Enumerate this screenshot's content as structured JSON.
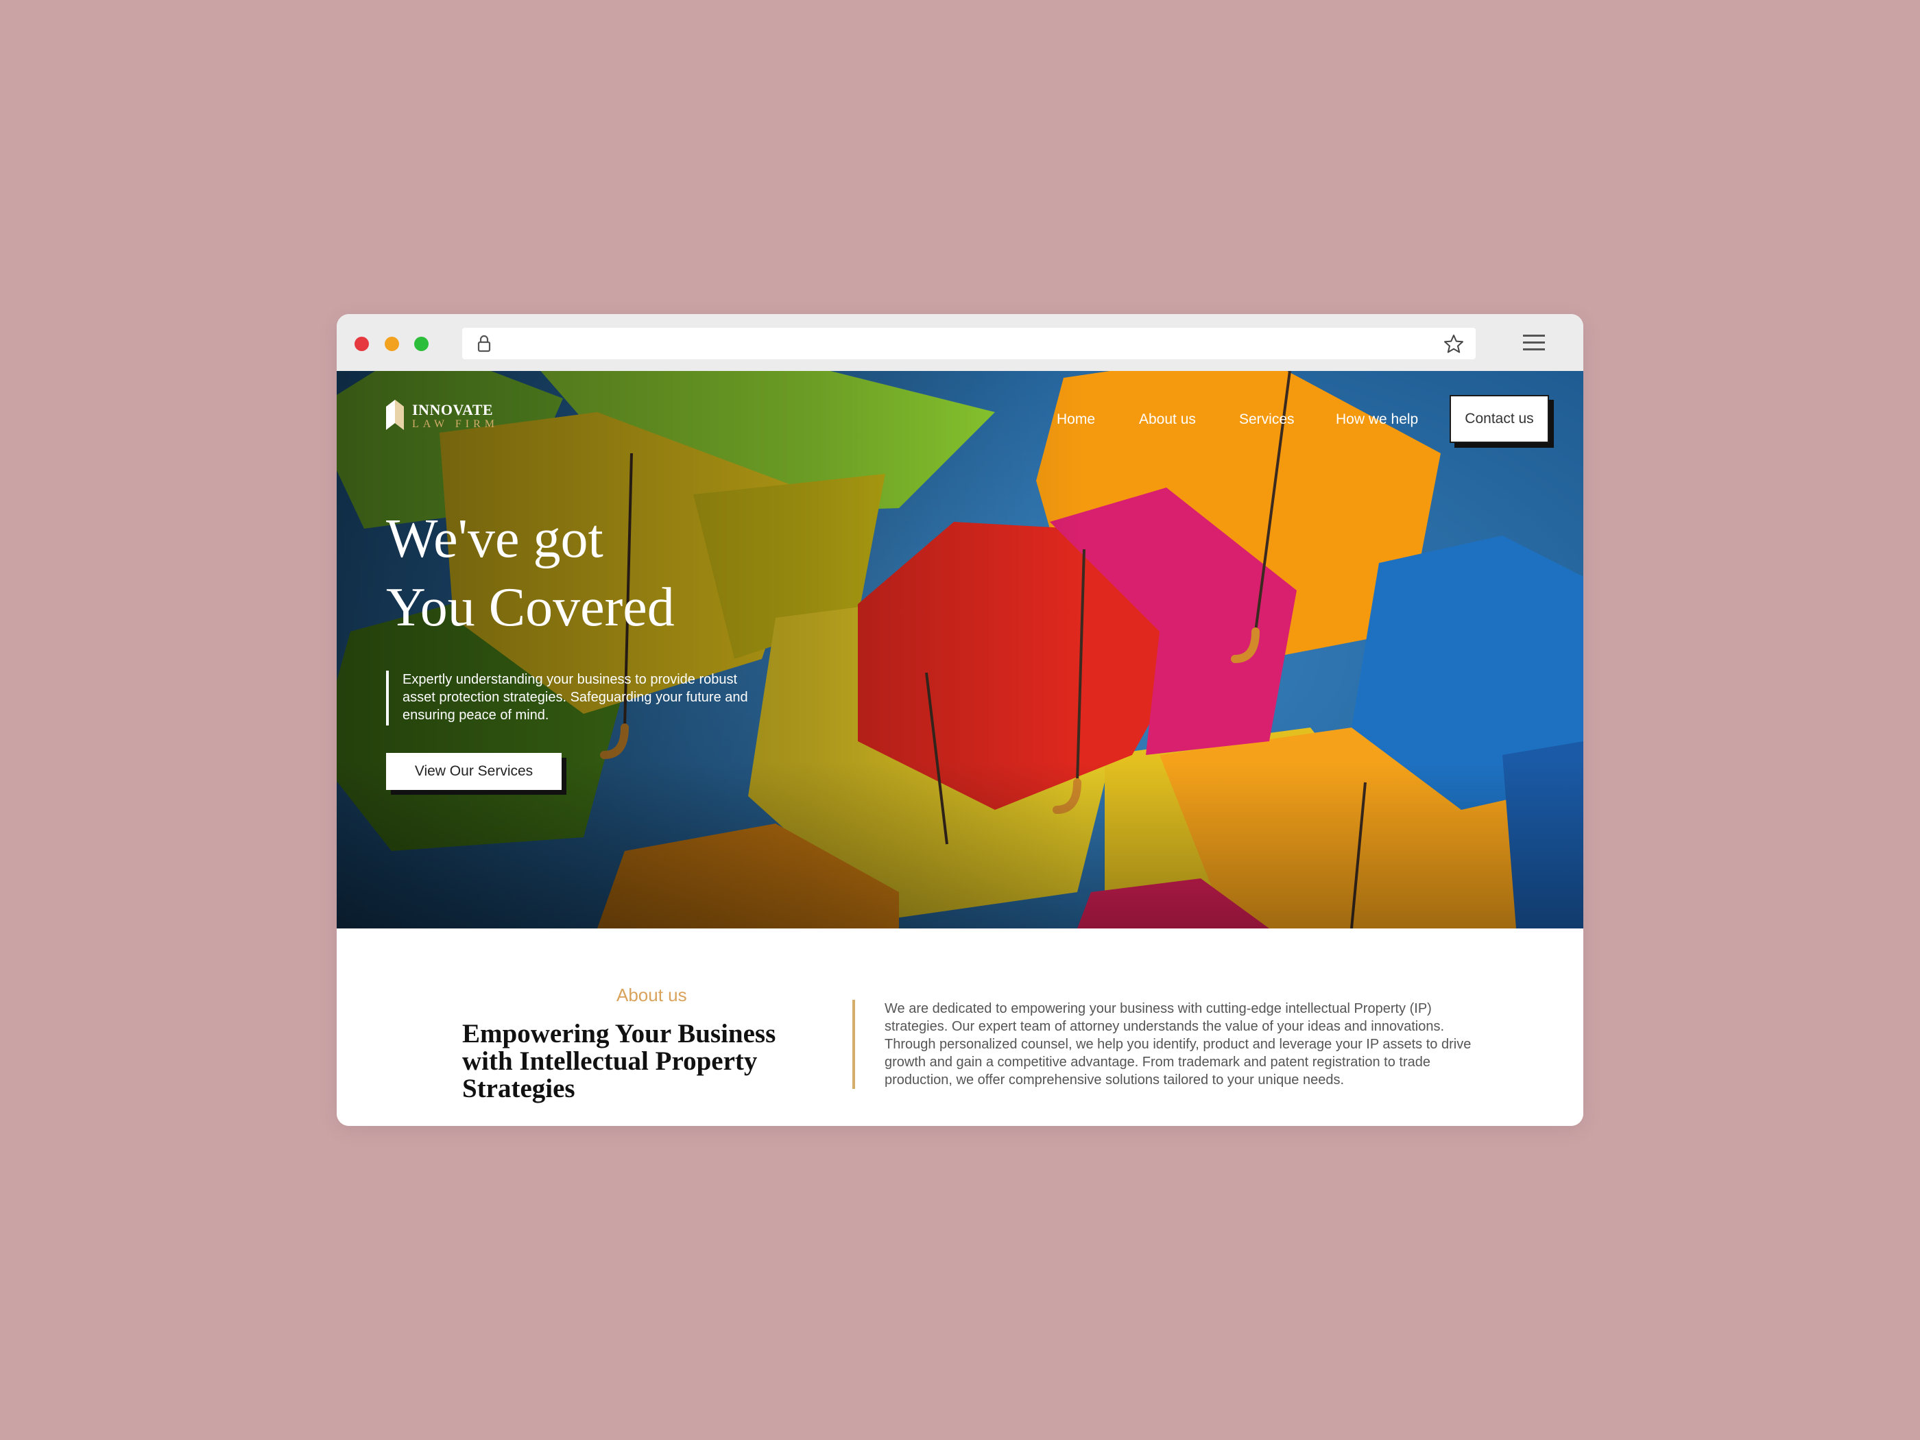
{
  "browser": {
    "url": "",
    "icons": [
      "lock-icon",
      "star-icon",
      "menu-icon"
    ]
  },
  "brand": {
    "name": "INNOVATE",
    "tagline": "LAW FIRM",
    "accent_color": "#d4ad6a"
  },
  "nav": {
    "items": [
      {
        "label": "Home"
      },
      {
        "label": "About us"
      },
      {
        "label": "Services"
      },
      {
        "label": "How we help"
      }
    ],
    "contact_label": "Contact us"
  },
  "hero": {
    "title_line1": "We've got",
    "title_line2": "You Covered",
    "description": "Expertly understanding your business to provide robust asset protection strategies. Safeguarding your future and ensuring peace of mind.",
    "cta_label": "View Our Services"
  },
  "about": {
    "eyebrow": "About us",
    "heading": "Empowering Your Business with Intellectual Property Strategies",
    "body": "We are dedicated to empowering your business with cutting-edge intellectual Property (IP) strategies. Our expert team of attorney understands the value of your ideas and innovations. Through personalized counsel, we help you identify, product and leverage your IP assets to drive growth and gain a competitive advantage. From trademark and patent registration to trade production, we offer comprehensive solutions tailored to your unique needs."
  },
  "colors": {
    "page_background": "#caa3a5",
    "eyebrow": "#d9a35c"
  }
}
